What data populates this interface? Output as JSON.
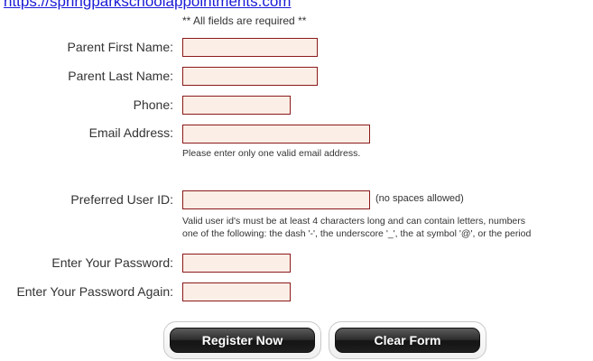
{
  "header": {
    "link_text": "https://springparkschoolappointments.com"
  },
  "form": {
    "required_note": "** All fields are required **",
    "fields": {
      "parent_first_name": {
        "label": "Parent First Name:",
        "value": ""
      },
      "parent_last_name": {
        "label": "Parent Last Name:",
        "value": ""
      },
      "phone": {
        "label": "Phone:",
        "value": ""
      },
      "email": {
        "label": "Email Address:",
        "value": "",
        "hint": "Please enter only one valid email address."
      },
      "user_id": {
        "label": "Preferred User ID:",
        "value": "",
        "inline_hint": "(no spaces allowed)",
        "hint_line1": "Valid user id's must be at least 4 characters long and can contain letters, numbers",
        "hint_line2": "one of the following: the dash '-', the underscore '_', the at symbol '@', or the period"
      },
      "password": {
        "label": "Enter Your Password:",
        "value": ""
      },
      "password_again": {
        "label": "Enter Your Password Again:",
        "value": ""
      }
    },
    "buttons": {
      "register": "Register Now",
      "clear": "Clear Form"
    }
  },
  "colors": {
    "field_background": "#fbeee6",
    "field_border": "#8b1a1a",
    "link": "#1a1ad6",
    "button_dark": "#1e1e1e"
  }
}
